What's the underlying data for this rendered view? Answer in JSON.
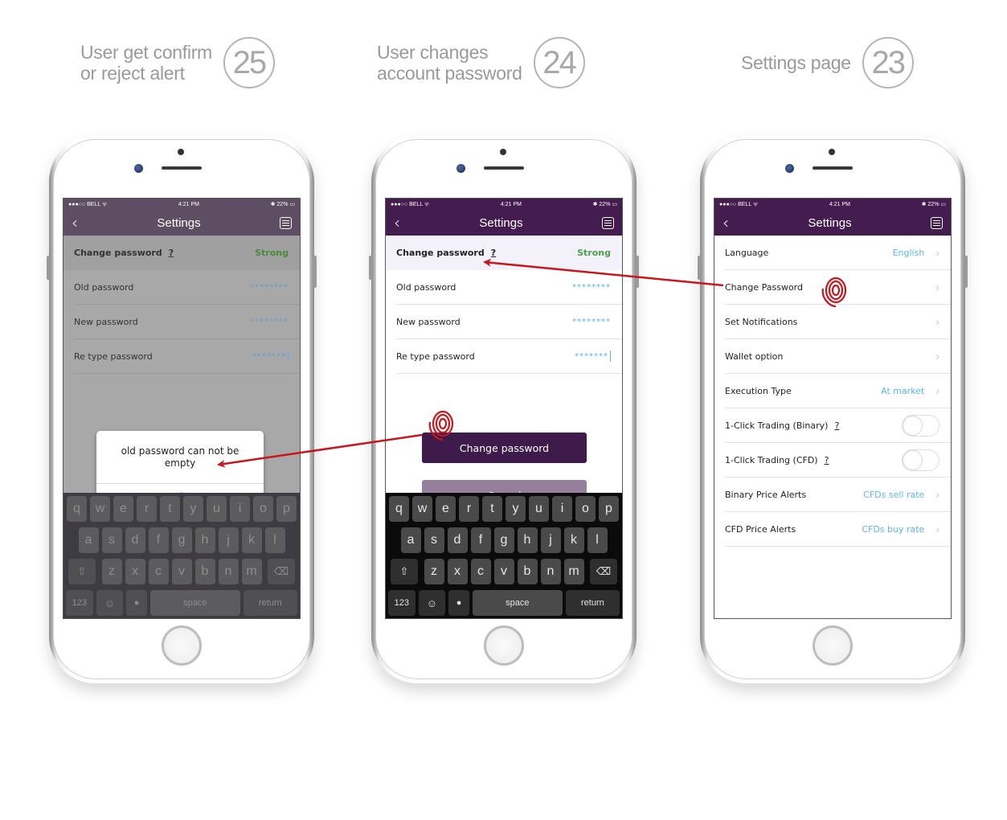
{
  "steps": [
    {
      "num": "25",
      "line1": "User get confirm",
      "line2": "or reject alert"
    },
    {
      "num": "24",
      "line1": "User changes",
      "line2": "account password"
    },
    {
      "num": "23",
      "line1": "Settings page",
      "line2": ""
    }
  ],
  "statusbar": {
    "carrier": "●●●○○ BELL ᯤ",
    "time": "4:21 PM",
    "battery": "✱ 22% ▭"
  },
  "nav": {
    "title": "Settings",
    "back_icon": "‹",
    "menu_icon": "menu-icon"
  },
  "password_form": {
    "header_label": "Change password",
    "help": "?",
    "strength": "Strong",
    "fields": [
      {
        "label": "Old password",
        "value": "********"
      },
      {
        "label": "New password",
        "value": "********"
      },
      {
        "label": "Re type password",
        "value": "*******"
      }
    ],
    "submit_label": "Change password",
    "cancel_label": "Cancel"
  },
  "alert": {
    "message": "old password can not be empty",
    "ok_label": "ok"
  },
  "keyboard": {
    "row1": [
      "q",
      "w",
      "e",
      "r",
      "t",
      "y",
      "u",
      "i",
      "o",
      "p"
    ],
    "row2": [
      "a",
      "s",
      "d",
      "f",
      "g",
      "h",
      "j",
      "k",
      "l"
    ],
    "row3": [
      "z",
      "x",
      "c",
      "v",
      "b",
      "n",
      "m"
    ],
    "shift": "⇧",
    "delete": "⌫",
    "num": "123",
    "emoji": "☺",
    "mic": "🎙",
    "space": "space",
    "return": "return"
  },
  "settings": {
    "items": [
      {
        "label": "Language",
        "value": "English",
        "type": "link"
      },
      {
        "label": "Change Password",
        "value": "",
        "type": "link"
      },
      {
        "label": "Set Notifications",
        "value": "",
        "type": "link"
      },
      {
        "label": "Wallet option",
        "value": "",
        "type": "link"
      },
      {
        "label": "Execution Type",
        "value": "At market",
        "type": "link"
      },
      {
        "label": "1-Click Trading (Binary)",
        "help": "?",
        "type": "toggle",
        "on": false
      },
      {
        "label": "1-Click Trading (CFD)",
        "help": "?",
        "type": "toggle",
        "on": false
      },
      {
        "label": "Binary Price Alerts",
        "value": "CFDs sell rate",
        "type": "link"
      },
      {
        "label": "CFD Price Alerts",
        "value": "CFDs buy rate",
        "type": "link"
      }
    ]
  },
  "colors": {
    "brand_purple": "#451c4f",
    "strong_green": "#4aa14a",
    "link_blue": "#5cb6ec",
    "annotation_red": "#c8161d"
  }
}
